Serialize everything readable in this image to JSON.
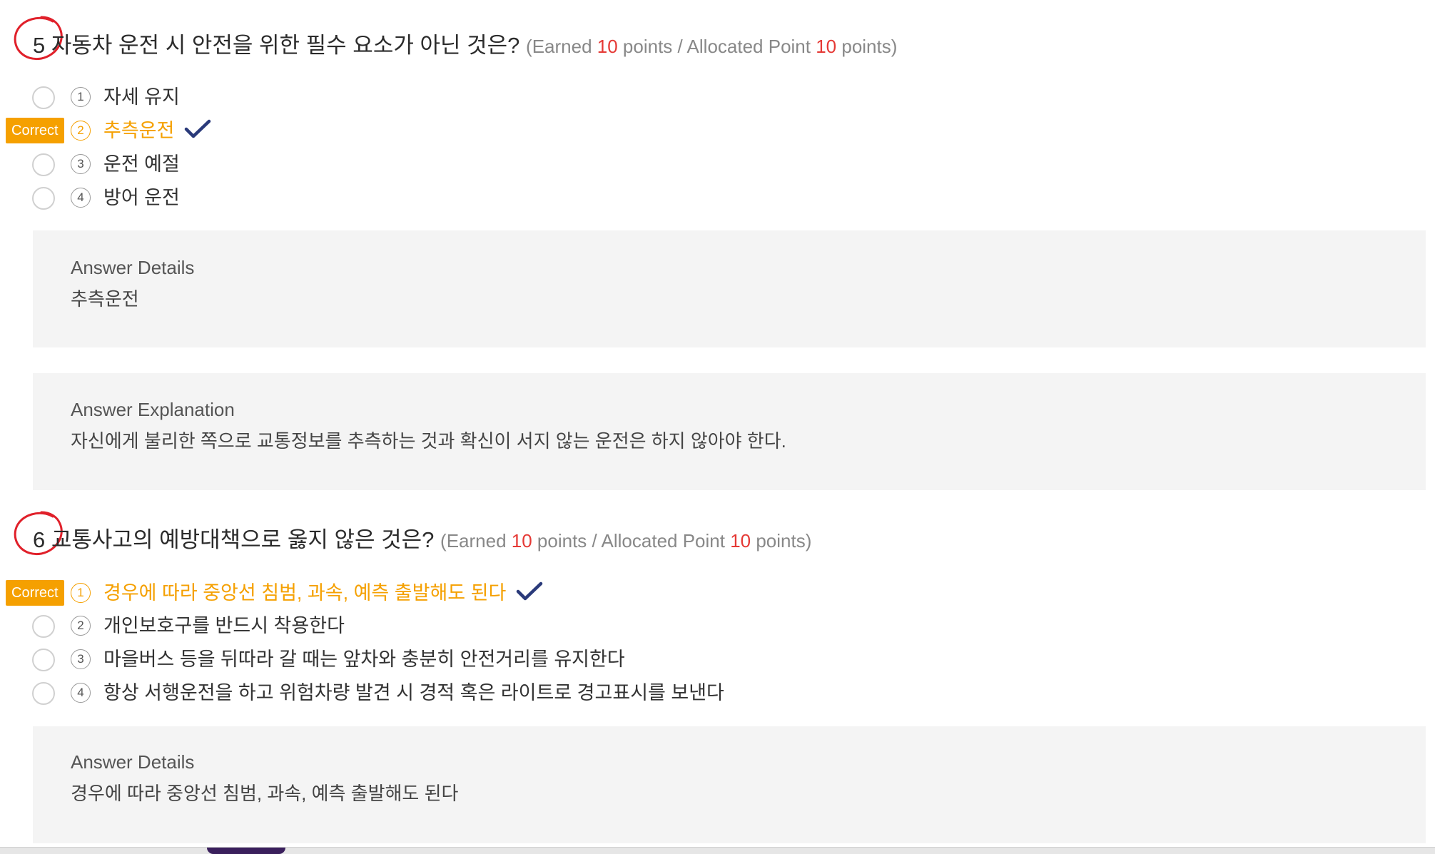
{
  "questions": [
    {
      "number": "5",
      "text": "자동차 운전 시 안전을 위한 필수 요소가 아닌 것은?",
      "score": {
        "open": "(Earned ",
        "earned": "10",
        "mid": " points / Allocated Point ",
        "allocated": "10",
        "close": " points)"
      },
      "options": [
        {
          "num": "1",
          "text": "자세 유지",
          "selected": false
        },
        {
          "num": "2",
          "text": "추측운전",
          "selected": true
        },
        {
          "num": "3",
          "text": "운전 예절",
          "selected": false
        },
        {
          "num": "4",
          "text": "방어 운전",
          "selected": false
        }
      ],
      "correct_label": "Correct",
      "details_label": "Answer Details",
      "details_text": "추측운전",
      "explanation_label": "Answer Explanation",
      "explanation_text": "자신에게 불리한 쪽으로 교통정보를 추측하는 것과 확신이 서지 않는 운전은 하지 않아야 한다."
    },
    {
      "number": "6",
      "text": "교통사고의 예방대책으로 옳지 않은 것은?",
      "score": {
        "open": "(Earned ",
        "earned": "10",
        "mid": " points / Allocated Point ",
        "allocated": "10",
        "close": " points)"
      },
      "options": [
        {
          "num": "1",
          "text": "경우에 따라 중앙선 침범, 과속, 예측 출발해도 된다",
          "selected": true
        },
        {
          "num": "2",
          "text": "개인보호구를 반드시 착용한다",
          "selected": false
        },
        {
          "num": "3",
          "text": "마을버스 등을 뒤따라 갈 때는 앞차와 충분히 안전거리를 유지한다",
          "selected": false
        },
        {
          "num": "4",
          "text": "항상 서행운전을 하고 위험차량 발견 시 경적 혹은 라이트로 경고표시를 보낸다",
          "selected": false
        }
      ],
      "correct_label": "Correct",
      "details_label": "Answer Details",
      "details_text": "경우에 따라 중앙선 침범, 과속, 예측 출발해도 된다"
    }
  ],
  "colors": {
    "correct": "#f5a000",
    "points": "#e53935",
    "check": "#2a3a7a",
    "grade_mark": "#e0202a",
    "panel": "#f4f4f4"
  },
  "icons": {
    "grade_mark": "red-circle-mark-icon",
    "check": "checkmark-icon"
  }
}
